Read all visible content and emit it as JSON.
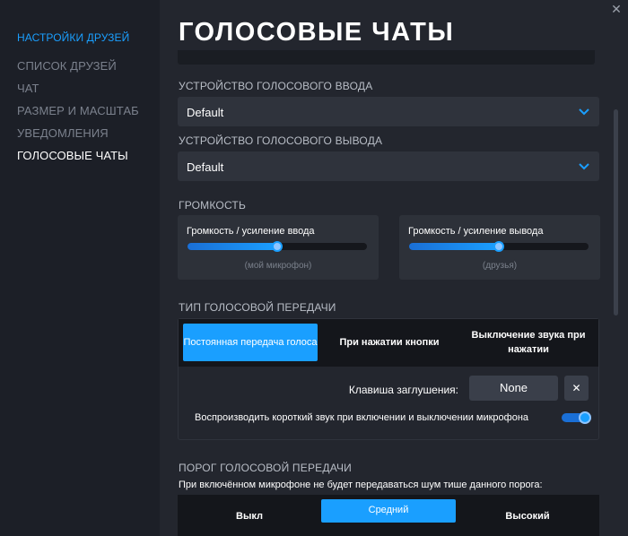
{
  "sidebar": {
    "header": "НАСТРОЙКИ ДРУЗЕЙ",
    "items": [
      {
        "label": "СПИСОК ДРУЗЕЙ"
      },
      {
        "label": "ЧАТ"
      },
      {
        "label": "РАЗМЕР И МАСШТАБ"
      },
      {
        "label": "УВЕДОМЛЕНИЯ"
      },
      {
        "label": "ГОЛОСОВЫЕ ЧАТЫ"
      }
    ],
    "active_index": 4
  },
  "window": {
    "close_glyph": "✕"
  },
  "page": {
    "title": "ГОЛОСОВЫЕ ЧАТЫ"
  },
  "input_device": {
    "label": "УСТРОЙСТВО ГОЛОСОВОГО ВВОДА",
    "value": "Default"
  },
  "output_device": {
    "label": "УСТРОЙСТВО ГОЛОСОВОГО ВЫВОДА",
    "value": "Default"
  },
  "volume": {
    "label": "ГРОМКОСТЬ",
    "input": {
      "title": "Громкость / усиление ввода",
      "caption": "(мой микрофон)",
      "level": 0.5
    },
    "output": {
      "title": "Громкость / усиление вывода",
      "caption": "(друзья)",
      "level": 0.5
    }
  },
  "transmission": {
    "label": "ТИП ГОЛОСОВОЙ ПЕРЕДАЧИ",
    "tabs": [
      {
        "label": "Постоянная передача голоса",
        "active": true
      },
      {
        "label": "При нажатии кнопки",
        "active": false
      },
      {
        "label": "Выключение звука при нажатии",
        "active": false
      }
    ],
    "mute_key_label": "Клавиша заглушения:",
    "mute_key_value": "None",
    "mute_clear": "✕",
    "beep_label": "Воспроизводить короткий звук при включении и выключении микрофона",
    "beep_enabled": true
  },
  "threshold": {
    "label": "ПОРОГ ГОЛОСОВОЙ ПЕРЕДАЧИ",
    "description": "При включённом микрофоне не будет передаваться шум тише данного порога:",
    "tabs": [
      {
        "label": "Выкл",
        "active": false
      },
      {
        "label": "Средний",
        "active": true
      },
      {
        "label": "Высокий",
        "active": false
      }
    ]
  },
  "colors": {
    "accent": "#1a9fff",
    "background": "#23262e",
    "sidebar": "#1c1f27"
  }
}
